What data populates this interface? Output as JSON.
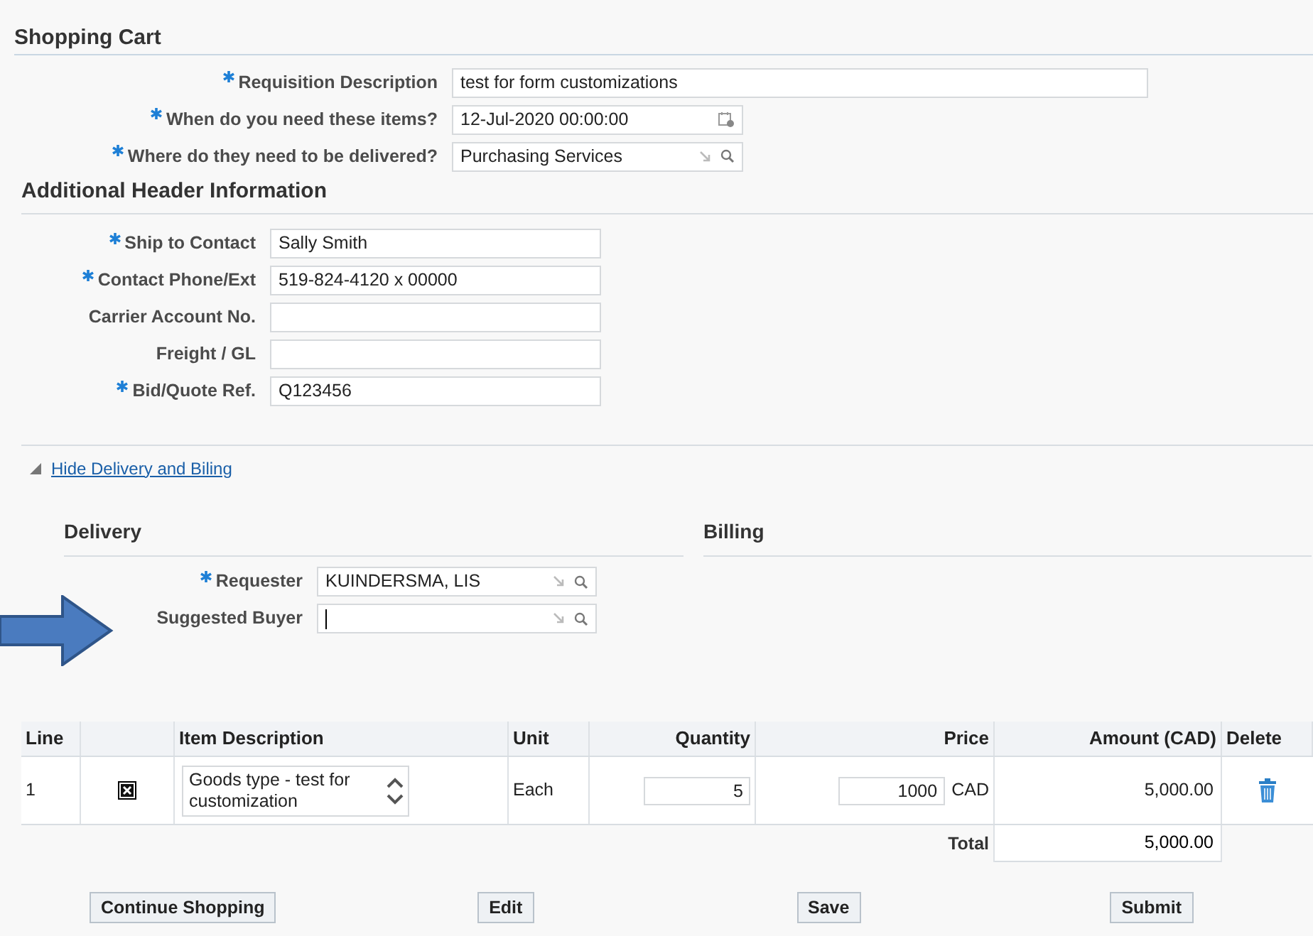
{
  "title": "Shopping Cart",
  "header_fields": [
    {
      "label": "Requisition Description",
      "required": true,
      "value": "test for form customizations",
      "kind": "text"
    },
    {
      "label": "When do you need these items?",
      "required": true,
      "value": "12-Jul-2020 00:00:00",
      "kind": "date"
    },
    {
      "label": "Where do they need to be delivered?",
      "required": true,
      "value": "Purchasing Services",
      "kind": "lov"
    }
  ],
  "additional_header": {
    "title": "Additional Header Information",
    "fields": [
      {
        "label": "Ship to Contact",
        "required": true,
        "value": "Sally Smith",
        "kind": "text"
      },
      {
        "label": "Contact Phone/Ext",
        "required": true,
        "value": "519-824-4120 x 00000",
        "kind": "text"
      },
      {
        "label": "Carrier Account No.",
        "required": false,
        "kind": "text"
      },
      {
        "label": "Freight / GL",
        "required": false,
        "kind": "text"
      },
      {
        "label": "Bid/Quote Ref.",
        "required": true,
        "value": "Q123456",
        "kind": "text"
      }
    ]
  },
  "disclosure": {
    "label": "Hide Delivery and Biling",
    "expanded": true
  },
  "delivery": {
    "title": "Delivery",
    "fields": [
      {
        "label": "Requester",
        "required": true,
        "value": "KUINDERSMA, LIS",
        "kind": "lov",
        "focused": false
      },
      {
        "label": "Suggested Buyer",
        "required": false,
        "kind": "lov",
        "focused": true
      }
    ]
  },
  "billing": {
    "title": "Billing"
  },
  "table": {
    "columns": [
      "Line",
      "",
      "Item Description",
      "Unit",
      "Quantity",
      "Price",
      "Amount (CAD)",
      "Delete"
    ],
    "rows": [
      {
        "line": "1",
        "description": "Goods type - test for customization",
        "unit": "Each",
        "quantity": "5",
        "price": "1000",
        "currency": "CAD",
        "amount": "5,000.00"
      }
    ],
    "total_label": "Total",
    "total": "5,000.00"
  },
  "buttons": [
    "Continue Shopping",
    "Edit",
    "Save",
    "Submit"
  ]
}
